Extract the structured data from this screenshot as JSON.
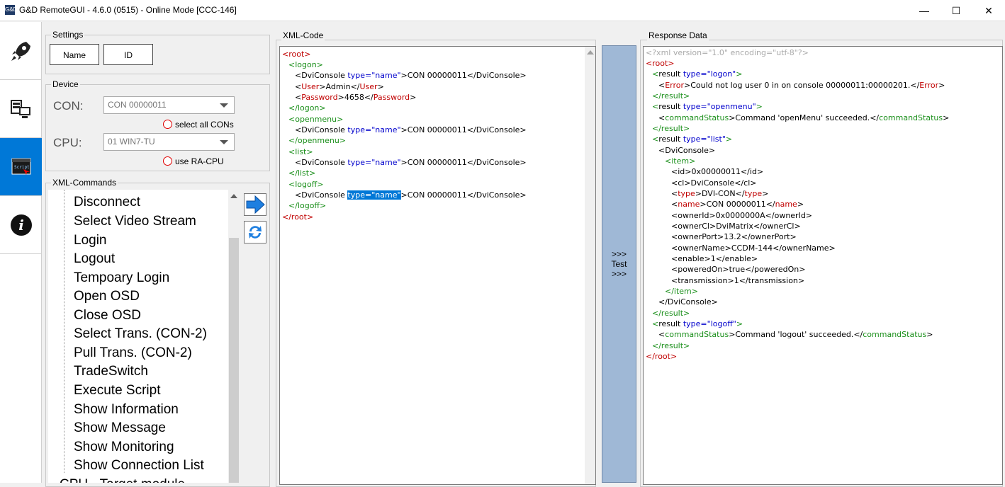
{
  "window": {
    "title": "G&D RemoteGUI - 4.6.0 (0515) - Online Mode [CCC-146]",
    "app_icon": "G&D",
    "minimize": "—",
    "maximize": "☐",
    "close": "✕"
  },
  "sidebar": {
    "items": [
      {
        "icon": "rocket-icon"
      },
      {
        "icon": "computer-network-icon"
      },
      {
        "icon": "script-icon",
        "active": true
      },
      {
        "icon": "info-icon",
        "glyph": "i"
      }
    ]
  },
  "settings": {
    "label": "Settings",
    "tabs": [
      "Name",
      "ID"
    ]
  },
  "device": {
    "label": "Device",
    "con_label": "CON:",
    "con_value": "CON 00000011",
    "select_all_cons": "select all CONs",
    "cpu_label": "CPU:",
    "cpu_value": "01 WIN7-TU",
    "use_ra_cpu": "use RA-CPU"
  },
  "xml_commands": {
    "label": "XML-Commands",
    "items": [
      "Disconnect",
      "Select Video Stream",
      "Login",
      "Logout",
      "Tempoary Login",
      "Open OSD",
      "Close OSD",
      "Select Trans. (CON-2)",
      "Pull Trans. (CON-2)",
      "TradeSwitch",
      "Execute Script",
      "Show Information",
      "Show Message",
      "Show Monitoring",
      "Show Connection List",
      "CPU - Target module"
    ]
  },
  "xml_code": {
    "label": "XML-Code"
  },
  "test_button": {
    "line1": ">>>",
    "line2": "Test",
    "line3": ">>>"
  },
  "response": {
    "label": "Response Data"
  }
}
